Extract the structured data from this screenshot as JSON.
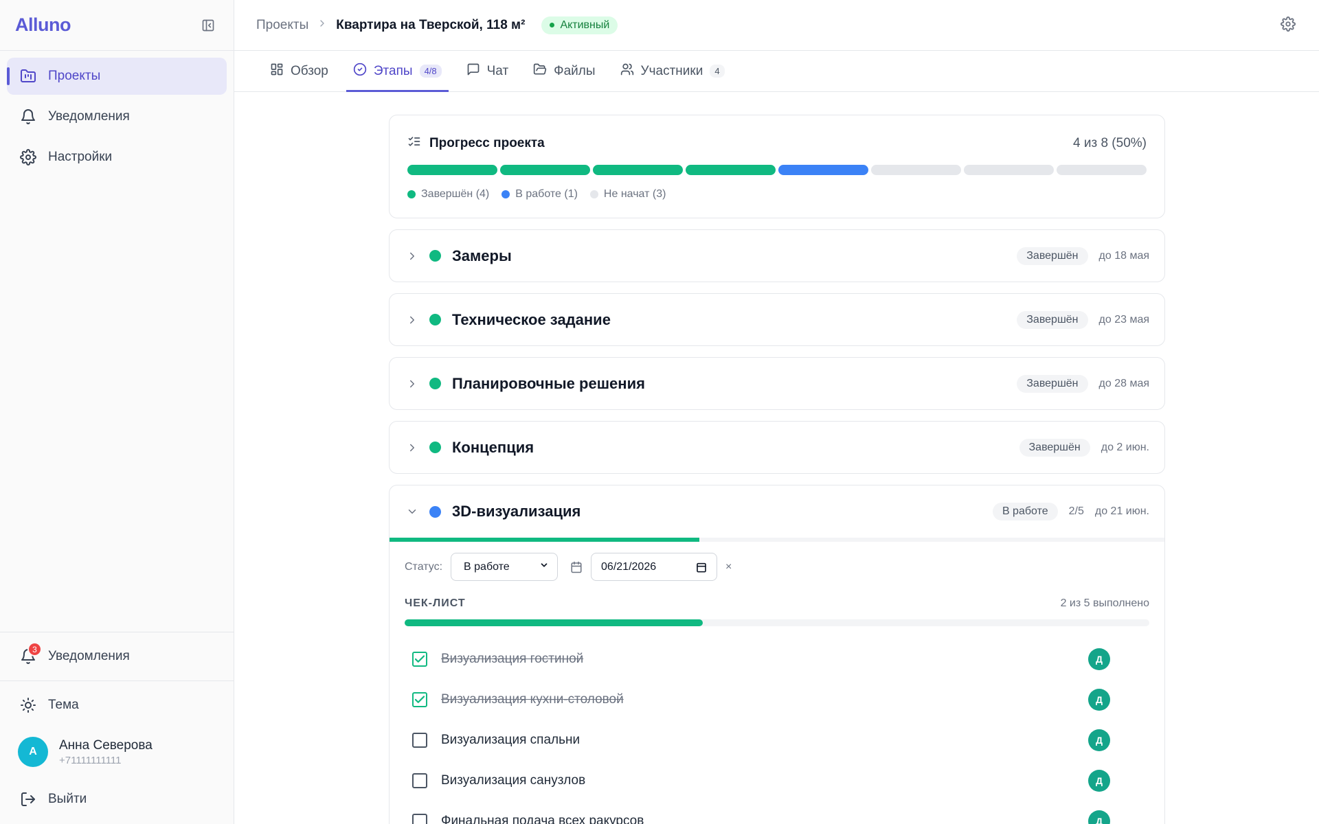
{
  "app": {
    "name": "Alluno"
  },
  "sidebar": {
    "items": [
      {
        "label": "Проекты",
        "icon": "folder-kanban-icon",
        "active": true
      },
      {
        "label": "Уведомления",
        "icon": "bell-icon"
      },
      {
        "label": "Настройки",
        "icon": "gear-icon"
      }
    ],
    "bottom": {
      "notifications_label": "Уведомления",
      "notifications_badge": "3",
      "theme_label": "Тема",
      "user": {
        "name": "Анна Северова",
        "phone": "+71111111111",
        "initial": "А"
      },
      "logout_label": "Выйти"
    }
  },
  "header": {
    "breadcrumb_root": "Проекты",
    "breadcrumb_current": "Квартира на Тверской, 118 м²",
    "status": "Активный"
  },
  "tabs": [
    {
      "label": "Обзор",
      "icon": "layout-grid-icon"
    },
    {
      "label": "Этапы",
      "icon": "check-circle-icon",
      "count": "4/8",
      "active": true
    },
    {
      "label": "Чат",
      "icon": "message-square-icon"
    },
    {
      "label": "Файлы",
      "icon": "folder-open-icon"
    },
    {
      "label": "Участники",
      "icon": "users-icon",
      "count": "4"
    }
  ],
  "progress": {
    "title": "Прогресс проекта",
    "summary": "4 из 8 (50%)",
    "segments": [
      "done",
      "done",
      "done",
      "done",
      "work",
      "todo",
      "todo",
      "todo"
    ],
    "legend": {
      "done": "Завершён (4)",
      "work": "В работе (1)",
      "todo": "Не начат (3)"
    },
    "colors": {
      "done": "#10b981",
      "work": "#3b82f6",
      "todo": "#e5e7eb"
    }
  },
  "stages": [
    {
      "name": "Замеры",
      "status": "Завершён",
      "due": "до 18 мая"
    },
    {
      "name": "Техническое задание",
      "status": "Завершён",
      "due": "до 23 мая"
    },
    {
      "name": "Планировочные решения",
      "status": "Завершён",
      "due": "до 28 мая"
    },
    {
      "name": "Концепция",
      "status": "Завершён",
      "due": "до 2 июн."
    }
  ],
  "open_stage": {
    "name": "3D-визуализация",
    "status": "В работе",
    "fraction": "2/5",
    "due": "до 21 июн.",
    "progress": 0.4,
    "status_label": "Статус:",
    "status_value": "В работе",
    "date_value": "06/21/2026",
    "clear_label": "×",
    "checklist_title": "ЧЕК-ЛИСТ",
    "checklist_count": "2 из 5 выполнено",
    "checklist_progress": 0.4,
    "items": [
      {
        "text": "Визуализация гостиной",
        "done": true,
        "assignee": "Д"
      },
      {
        "text": "Визуализация кухни-столовой",
        "done": true,
        "assignee": "Д"
      },
      {
        "text": "Визуализация спальни",
        "done": false,
        "assignee": "Д"
      },
      {
        "text": "Визуализация санузлов",
        "done": false,
        "assignee": "Д"
      },
      {
        "text": "Финальная подача всех ракурсов",
        "done": false,
        "assignee": "Д"
      }
    ]
  }
}
